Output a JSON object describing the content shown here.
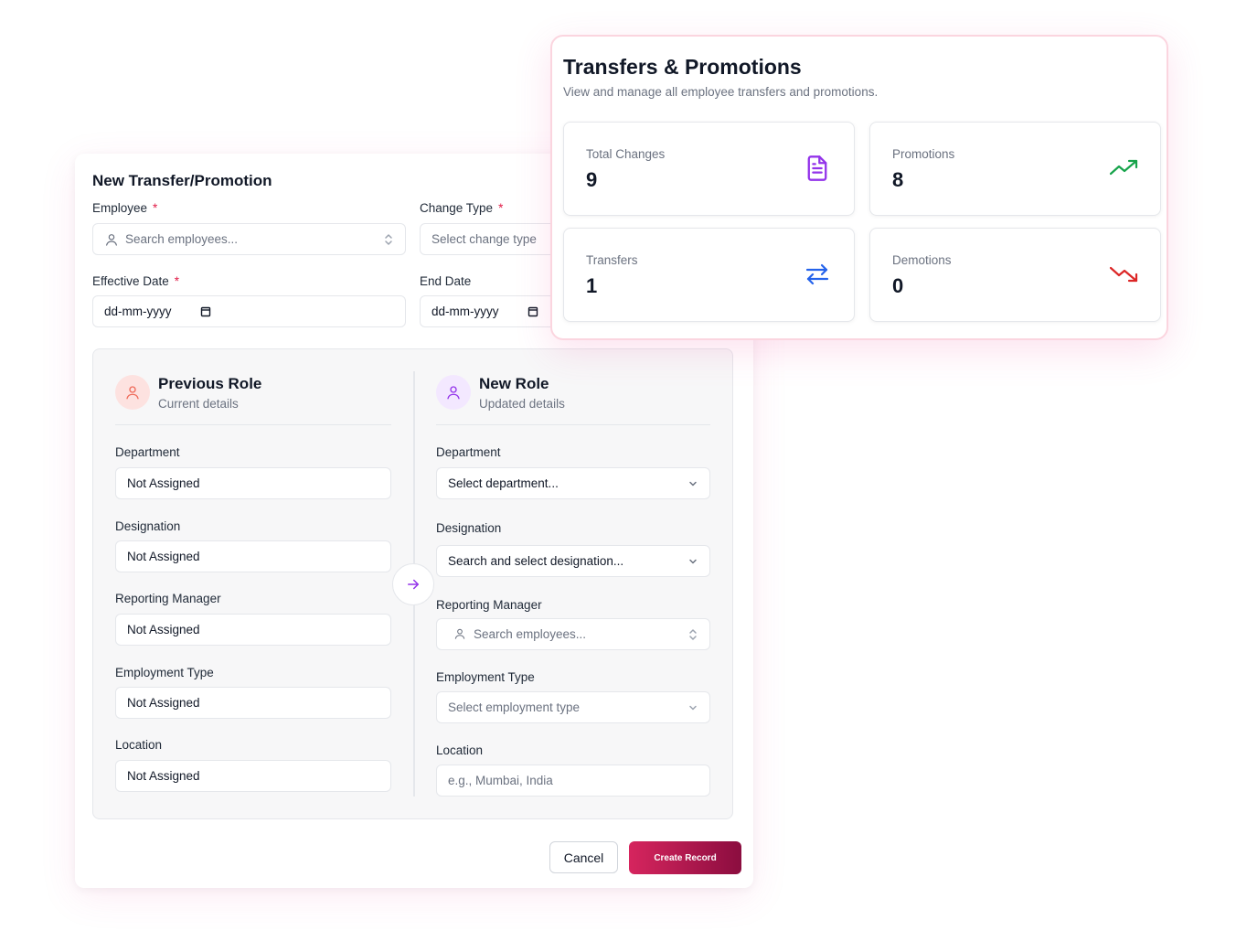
{
  "form": {
    "title": "New Transfer/Promotion",
    "required_mark": "*",
    "employee_label": "Employee",
    "employee_placeholder": "Search employees...",
    "change_type_label": "Change Type",
    "change_type_placeholder": "Select change type",
    "effective_date_label": "Effective Date",
    "effective_date_value": "dd-mm-yyyy",
    "end_date_label": "End Date",
    "end_date_value": "dd-mm-yyyy",
    "previous": {
      "title": "Previous Role",
      "subtitle": "Current details",
      "department_label": "Department",
      "department_value": "Not Assigned",
      "designation_label": "Designation",
      "designation_value": "Not Assigned",
      "manager_label": "Reporting Manager",
      "manager_value": "Not Assigned",
      "employment_type_label": "Employment Type",
      "employment_type_value": "Not Assigned",
      "location_label": "Location",
      "location_value": "Not Assigned"
    },
    "new": {
      "title": "New Role",
      "subtitle": "Updated details",
      "department_label": "Department",
      "department_value": "Select department...",
      "designation_label": "Designation",
      "designation_value": "Search and select designation...",
      "manager_label": "Reporting Manager",
      "manager_placeholder": "Search employees...",
      "employment_type_label": "Employment Type",
      "employment_type_placeholder": "Select employment type",
      "location_label": "Location",
      "location_placeholder": "e.g., Mumbai, India"
    },
    "cancel_label": "Cancel",
    "create_label": "Create Record"
  },
  "stats": {
    "title": "Transfers & Promotions",
    "subtitle": "View and manage all employee transfers and promotions.",
    "cards": [
      {
        "label": "Total Changes",
        "value": "9",
        "icon": "document-icon",
        "color": "#9333ea"
      },
      {
        "label": "Promotions",
        "value": "8",
        "icon": "trending-up-icon",
        "color": "#16a34a"
      },
      {
        "label": "Transfers",
        "value": "1",
        "icon": "swap-arrows-icon",
        "color": "#2563eb"
      },
      {
        "label": "Demotions",
        "value": "0",
        "icon": "trending-down-icon",
        "color": "#dc2626"
      }
    ]
  },
  "colors": {
    "accent_start": "#d6255e",
    "accent_end": "#8b0d3f",
    "required": "#e11d48",
    "previous_avatar_bg": "#fde2e0",
    "new_avatar_bg": "#f3e8ff"
  }
}
